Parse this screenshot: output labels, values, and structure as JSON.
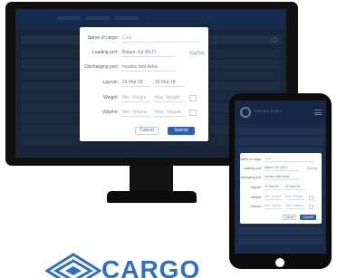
{
  "desktop_form": {
    "fields": [
      {
        "label": "Name of cargo:",
        "value": "Coal",
        "placeholder": true
      },
      {
        "label": "Loading port:",
        "value": "Batam, Kp (BLT)",
        "aux": "Kg/Day"
      },
      {
        "label": "Discharging port:",
        "value": "Inoaloo bett Acba",
        "placeholder": true
      },
      {
        "label": "Laycan:",
        "value": "29 Mar 18",
        "value2": "25 Mar 18"
      },
      {
        "label": "Weight:",
        "value": "Min. Weight",
        "value2": "Max. Weight",
        "placeholder": true
      },
      {
        "label": "Volume:",
        "value": "Min. Volume",
        "value2": "Max. Volume",
        "placeholder": true
      }
    ],
    "cancel_label": "Cancel",
    "submit_label": "Submit"
  },
  "tablet_form": {
    "brand": "CARGO PORT",
    "fields": [
      {
        "label": "Name of cargo:",
        "value": "Coal",
        "placeholder": true
      },
      {
        "label": "Loading port:",
        "value": "Batam, Kp (BLT)",
        "aux": "Kg/Day"
      },
      {
        "label": "Discharging port:",
        "value": "Inoaloo bett Acba",
        "placeholder": true
      },
      {
        "label": "Laycan:",
        "value": "29 Mar 18",
        "value2": "25 Mar 18"
      },
      {
        "label": "Weight:",
        "value": "Min. Weight",
        "value2": "Max. Weight",
        "placeholder": true
      },
      {
        "label": "Volume:",
        "value": "Min. Volume",
        "value2": "Max. Volume",
        "placeholder": true
      }
    ],
    "cancel_label": "Cancel",
    "submit_label": "Submit"
  },
  "logo": {
    "text": "CARGO"
  },
  "colors": {
    "primary": "#2d5fb0",
    "screen_bg": "#26374f",
    "logo": "#2f6fc2"
  }
}
